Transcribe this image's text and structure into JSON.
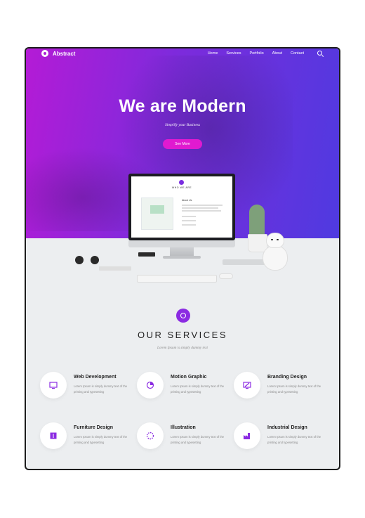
{
  "nav": {
    "logo": "Abstract",
    "links": [
      "Home",
      "Services",
      "Portfolio",
      "About",
      "Contact"
    ]
  },
  "hero": {
    "title": "We are Modern",
    "subtitle": "Simplify your Business",
    "cta": "See More"
  },
  "monitor_screen": {
    "label": "WHO WE ARE",
    "subheading": "About Us"
  },
  "services": {
    "title": "OUR SERVICES",
    "subtitle": "Lorem Ipsum is simply dummy text",
    "items": [
      {
        "name": "Web Development",
        "desc": "Lorem Ipsum is simply dummy text of the printing and typesetting",
        "icon": "monitor-icon"
      },
      {
        "name": "Motion Graphic",
        "desc": "Lorem Ipsum is simply dummy text of the printing and typesetting",
        "icon": "pie-chart-icon"
      },
      {
        "name": "Branding Design",
        "desc": "Lorem Ipsum is simply dummy text of the printing and typesetting",
        "icon": "design-screen-icon"
      },
      {
        "name": "Furniture Design",
        "desc": "Lorem Ipsum is simply dummy text of the printing and typesetting",
        "icon": "book-icon"
      },
      {
        "name": "Illustration",
        "desc": "Lorem Ipsum is simply dummy text of the printing and typesetting",
        "icon": "dotted-circle-icon"
      },
      {
        "name": "Industrial Design",
        "desc": "Lorem Ipsum is simply dummy text of the printing and typesetting",
        "icon": "factory-icon"
      }
    ]
  },
  "colors": {
    "accent": "#8b2be2",
    "hero_gradient_start": "#b41bd6",
    "hero_gradient_end": "#4f3ae0",
    "button": "#e01ad0"
  }
}
